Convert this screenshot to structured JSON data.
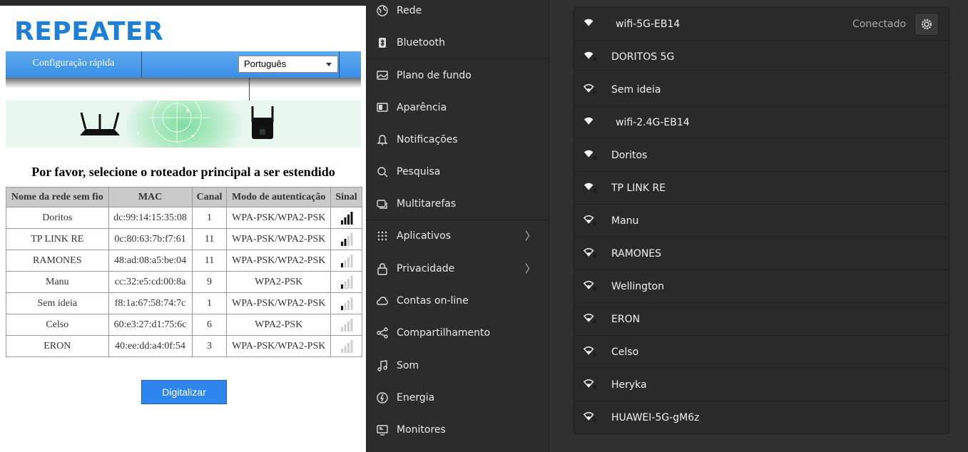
{
  "repeater": {
    "logo": "REPEATER",
    "nav": {
      "quick_setup": "Configuração rápida"
    },
    "language": "Português",
    "heading": "Por favor, selecione o roteador principal a ser estendido",
    "table": {
      "headers": [
        "Nome da rede sem fio",
        "MAC",
        "Canal",
        "Modo de autenticação",
        "Sinal"
      ],
      "rows": [
        {
          "name": "Doritos",
          "mac": "dc:99:14:15:35:08",
          "channel": "1",
          "auth": "WPA-PSK/WPA2-PSK",
          "signal_level": 4
        },
        {
          "name": "TP LINK RE",
          "mac": "0c:80:63:7b:f7:61",
          "channel": "11",
          "auth": "WPA-PSK/WPA2-PSK",
          "signal_level": 2
        },
        {
          "name": "RAMONES",
          "mac": "48:ad:08:a5:be:04",
          "channel": "11",
          "auth": "WPA-PSK/WPA2-PSK",
          "signal_level": 1
        },
        {
          "name": "Manu",
          "mac": "cc:32:e5:cd:00:8a",
          "channel": "9",
          "auth": "WPA2-PSK",
          "signal_level": 1
        },
        {
          "name": "Sem ideia",
          "mac": "f8:1a:67:58:74:7c",
          "channel": "1",
          "auth": "WPA-PSK/WPA2-PSK",
          "signal_level": 1
        },
        {
          "name": "Celso",
          "mac": "60:e3:27:d1:75:6c",
          "channel": "6",
          "auth": "WPA2-PSK",
          "signal_level": 0
        },
        {
          "name": "ERON",
          "mac": "40:ee:dd:a4:0f:54",
          "channel": "3",
          "auth": "WPA-PSK/WPA2-PSK",
          "signal_level": 0
        }
      ]
    },
    "scan_button": "Digitalizar"
  },
  "sidebar": {
    "items": [
      {
        "label": "Rede",
        "icon": "globe-icon"
      },
      {
        "label": "Bluetooth",
        "icon": "bluetooth-icon"
      },
      {
        "label": "Plano de fundo",
        "icon": "wallpaper-icon"
      },
      {
        "label": "Aparência",
        "icon": "appearance-icon"
      },
      {
        "label": "Notificações",
        "icon": "bell-icon"
      },
      {
        "label": "Pesquisa",
        "icon": "search-icon"
      },
      {
        "label": "Multitarefas",
        "icon": "multitasking-icon"
      },
      {
        "label": "Aplicativos",
        "icon": "apps-grid-icon",
        "chevron": true
      },
      {
        "label": "Privacidade",
        "icon": "lock-icon",
        "chevron": true
      },
      {
        "label": "Contas on-line",
        "icon": "cloud-icon"
      },
      {
        "label": "Compartilhamento",
        "icon": "share-icon"
      },
      {
        "label": "Som",
        "icon": "music-note-icon"
      },
      {
        "label": "Energia",
        "icon": "power-icon"
      },
      {
        "label": "Monitores",
        "icon": "monitor-icon"
      }
    ]
  },
  "wifi": {
    "networks": [
      {
        "name": "wifi-5G-EB14",
        "secured": false,
        "connected": true
      },
      {
        "name": "DORITOS 5G",
        "secured": true
      },
      {
        "name": "Sem ideia",
        "secured": true
      },
      {
        "name": "wifi-2.4G-EB14",
        "secured": false
      },
      {
        "name": "Doritos",
        "secured": true
      },
      {
        "name": "TP LINK RE",
        "secured": true
      },
      {
        "name": "Manu",
        "secured": true
      },
      {
        "name": "RAMONES",
        "secured": true
      },
      {
        "name": "Wellington",
        "secured": true
      },
      {
        "name": "ERON",
        "secured": true
      },
      {
        "name": "Celso",
        "secured": true
      },
      {
        "name": "Heryka",
        "secured": true
      },
      {
        "name": "HUAWEI-5G-gM6z",
        "secured": true
      }
    ],
    "status_connected": "Conectado"
  }
}
